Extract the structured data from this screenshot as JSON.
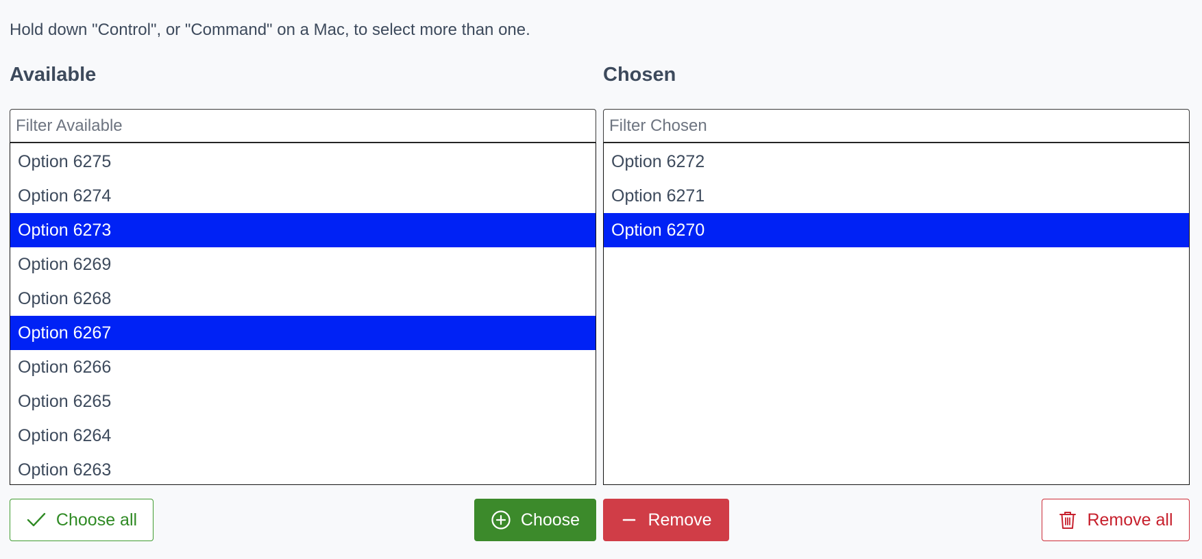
{
  "help_text": "Hold down \"Control\", or \"Command\" on a Mac, to select more than one.",
  "available": {
    "title": "Available",
    "filter_placeholder": "Filter Available",
    "options": [
      {
        "label": "Option 6275",
        "selected": false
      },
      {
        "label": "Option 6274",
        "selected": false
      },
      {
        "label": "Option 6273",
        "selected": true
      },
      {
        "label": "Option 6269",
        "selected": false
      },
      {
        "label": "Option 6268",
        "selected": false
      },
      {
        "label": "Option 6267",
        "selected": true
      },
      {
        "label": "Option 6266",
        "selected": false
      },
      {
        "label": "Option 6265",
        "selected": false
      },
      {
        "label": "Option 6264",
        "selected": false
      },
      {
        "label": "Option 6263",
        "selected": false
      }
    ]
  },
  "chosen": {
    "title": "Chosen",
    "filter_placeholder": "Filter Chosen",
    "options": [
      {
        "label": "Option 6272",
        "selected": false
      },
      {
        "label": "Option 6271",
        "selected": false
      },
      {
        "label": "Option 6270",
        "selected": true
      }
    ]
  },
  "buttons": {
    "choose_all": {
      "label": "Choose all",
      "icon": "check-icon"
    },
    "choose": {
      "label": "Choose",
      "icon": "plus-circle-icon"
    },
    "remove": {
      "label": "Remove",
      "icon": "minus-icon"
    },
    "remove_all": {
      "label": "Remove all",
      "icon": "trash-icon"
    }
  },
  "colors": {
    "selection": "#0022f5",
    "choose_green": "#3c8a2b",
    "remove_red": "#d03d47"
  }
}
